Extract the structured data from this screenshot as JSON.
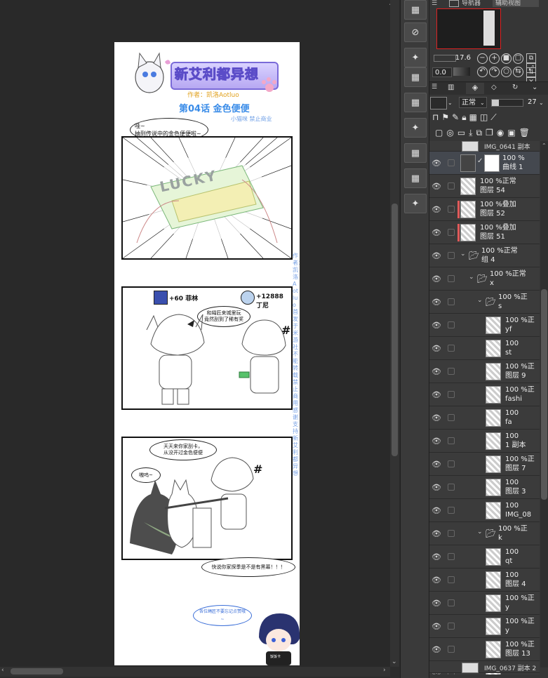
{
  "colors": {
    "accent": "#e05a5a",
    "panel_bg": "#363636",
    "canvas_bg": "#292929"
  },
  "comic": {
    "title": "新艾利都异想",
    "author": "作者：凯洛Aotluo",
    "episode": "第04话 金色便便",
    "credit": "小猫咪 禁止商业",
    "panel1_bubble": "哇~\n抽到传说中的金色便便啦~",
    "lucky_text": "LUCKY",
    "panel2_left_count": "+60 菲林",
    "panel2_right_count": "+12888 丁尼",
    "panel2_bubble": "和绳匠来城里玩\n竟然刮到了稀有奖",
    "panel3_bubble1": "天天来你家刮卡，\n从没开过金色便便",
    "panel3_bubble2": "嗷呜~",
    "panel3_bubble3": "快说你家探季是不是有黑幕！！！",
    "footer_bubble": "各位绳匠不要忘记点赞哦~",
    "shirt_text": "饭饭卡",
    "side_text": "作者：凯洛Aotluo 首发于米游社 不能转载 禁止商用 感谢支持新艾利都异想"
  },
  "toolbar": {
    "icons": [
      "grid-icon",
      "rotate-icon",
      "star-icon",
      "grid-icon",
      "grid-icon",
      "star-icon",
      "grid-icon",
      "grid-icon",
      "grid-icon",
      "star-icon"
    ]
  },
  "navigator": {
    "tab1": "导航器",
    "tab2": "辅助视图",
    "zoom": "17.6",
    "angle": "0.0"
  },
  "layers_panel": {
    "blend_mode": "正常",
    "opacity": "27",
    "top_partial": "IMG_0641 副本",
    "bottom_partial": "IMG_0637 副本 2",
    "items": [
      {
        "pct": "100 %",
        "name": "曲线 1",
        "indent": 0,
        "kind": "adjust",
        "sel": true
      },
      {
        "pct": "100 %正常",
        "name": "图层 54",
        "indent": 0,
        "kind": "layer"
      },
      {
        "pct": "100 %叠加",
        "name": "图层 52",
        "indent": 0,
        "kind": "layer",
        "red": true
      },
      {
        "pct": "100 %叠加",
        "name": "图层 51",
        "indent": 0,
        "kind": "layer",
        "red": true
      },
      {
        "pct": "100 %正常",
        "name": "组 4",
        "indent": 0,
        "kind": "folder"
      },
      {
        "pct": "100 %正常",
        "name": "x",
        "indent": 1,
        "kind": "folder"
      },
      {
        "pct": "100 %正",
        "name": "s",
        "indent": 2,
        "kind": "folder"
      },
      {
        "pct": "100 %正",
        "name": "yf",
        "indent": 3,
        "kind": "layer"
      },
      {
        "pct": "100",
        "name": "st",
        "indent": 3,
        "kind": "layer"
      },
      {
        "pct": "100 %正",
        "name": "图层 9",
        "indent": 3,
        "kind": "layer"
      },
      {
        "pct": "100 %正",
        "name": "fashi",
        "indent": 3,
        "kind": "layer"
      },
      {
        "pct": "100",
        "name": "fa",
        "indent": 3,
        "kind": "layer"
      },
      {
        "pct": "100",
        "name": "1 副本",
        "indent": 3,
        "kind": "layer"
      },
      {
        "pct": "100 %正",
        "name": "图层 7",
        "indent": 3,
        "kind": "layer"
      },
      {
        "pct": "100",
        "name": "图层 3",
        "indent": 3,
        "kind": "layer"
      },
      {
        "pct": "100",
        "name": "IMG_08",
        "indent": 3,
        "kind": "layer"
      },
      {
        "pct": "100 %正",
        "name": "k",
        "indent": 2,
        "kind": "folder"
      },
      {
        "pct": "100",
        "name": "qt",
        "indent": 3,
        "kind": "layer"
      },
      {
        "pct": "100",
        "name": "图层 4",
        "indent": 3,
        "kind": "layer"
      },
      {
        "pct": "100 %正",
        "name": "y",
        "indent": 3,
        "kind": "layer"
      },
      {
        "pct": "100 %正",
        "name": "y",
        "indent": 3,
        "kind": "layer"
      },
      {
        "pct": "100 %正",
        "name": "图层 13",
        "indent": 3,
        "kind": "layer"
      },
      {
        "pct": "100",
        "name": "",
        "indent": 3,
        "kind": "layer"
      }
    ]
  }
}
